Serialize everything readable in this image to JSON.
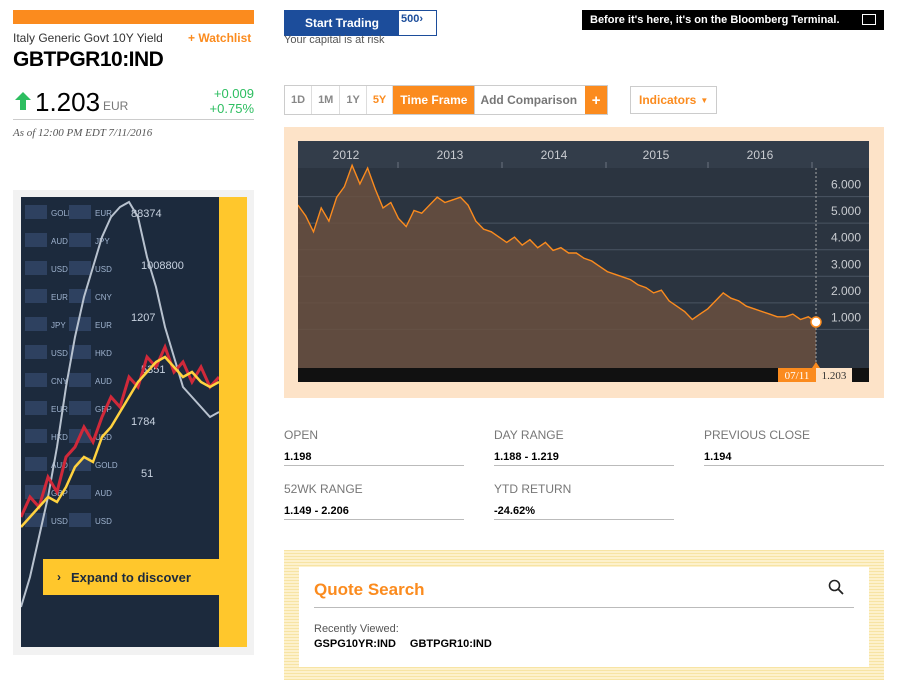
{
  "header": {
    "security_name": "Italy Generic Govt 10Y Yield",
    "watchlist_label": "+ Watchlist",
    "ticker": "GBTPGR10:IND",
    "price": "1.203",
    "currency": "EUR",
    "change": "+0.009",
    "change_pct": "+0.75%",
    "as_of": "As of 12:00 PM EDT 7/11/2016"
  },
  "ad": {
    "cta_label": "Expand to discover",
    "board_labels": [
      "GOLD",
      "AUD",
      "USD",
      "EUR",
      "JPY",
      "USD",
      "CNY",
      "EUR",
      "HKD",
      "AUD",
      "GBP",
      "USD"
    ],
    "board_numbers": [
      "88374",
      "1008800",
      "1207",
      "5351",
      "1784",
      "51"
    ]
  },
  "banners": {
    "start_trading": "Start Trading",
    "start_trading_logo": "500",
    "capital_risk": "Your capital is at risk",
    "bloomberg_terminal": "Before it's here, it's on the Bloomberg Terminal."
  },
  "controls": {
    "timeframes": [
      "1D",
      "1M",
      "1Y",
      "5Y"
    ],
    "active_timeframe": "5Y",
    "time_frame_label": "Time Frame",
    "add_comparison": "Add Comparison",
    "plus": "+",
    "indicators": "Indicators"
  },
  "chart_data": {
    "type": "area",
    "x_ticks": [
      "2012",
      "2013",
      "2014",
      "2015",
      "2016"
    ],
    "y_ticks": [
      "6.000",
      "5.000",
      "4.000",
      "3.000",
      "2.000",
      "1.000"
    ],
    "ylim": [
      0,
      7
    ],
    "last_date_label": "07/11",
    "last_value_label": "1.203",
    "colors": {
      "line": "#fb8b1e",
      "fill": "#6a5040",
      "bg": "#2b3440"
    },
    "series": [
      {
        "values": [
          5.6,
          5.2,
          4.6,
          5.5,
          5.0,
          5.9,
          6.3,
          7.1,
          6.4,
          7.0,
          6.2,
          5.5,
          5.7,
          5.1,
          4.8,
          5.4,
          5.3,
          5.6,
          5.9,
          5.7,
          5.8,
          5.9,
          5.6,
          5.0,
          4.7,
          4.6,
          4.4,
          4.2,
          4.4,
          4.1,
          4.3,
          4.0,
          4.2,
          3.9,
          4.0,
          3.8,
          3.8,
          3.6,
          3.5,
          3.3,
          3.1,
          3.0,
          2.9,
          2.8,
          2.6,
          2.5,
          2.3,
          2.4,
          2.0,
          1.8,
          1.6,
          1.3,
          1.5,
          1.7,
          2.0,
          2.3,
          2.1,
          2.0,
          1.8,
          1.7,
          1.6,
          1.5,
          1.4,
          1.4,
          1.5,
          1.3,
          1.4,
          1.203
        ]
      }
    ]
  },
  "stats": [
    {
      "label": "OPEN",
      "value": "1.198"
    },
    {
      "label": "DAY RANGE",
      "value": "1.188 - 1.219"
    },
    {
      "label": "PREVIOUS CLOSE",
      "value": "1.194"
    },
    {
      "label": "52WK RANGE",
      "value": "1.149 - 2.206"
    },
    {
      "label": "YTD RETURN",
      "value": "-24.62%"
    }
  ],
  "quote_search": {
    "title": "Quote Search",
    "recently_viewed_label": "Recently Viewed:",
    "recent": [
      "GSPG10YR:IND",
      "GBTPGR10:IND"
    ]
  }
}
